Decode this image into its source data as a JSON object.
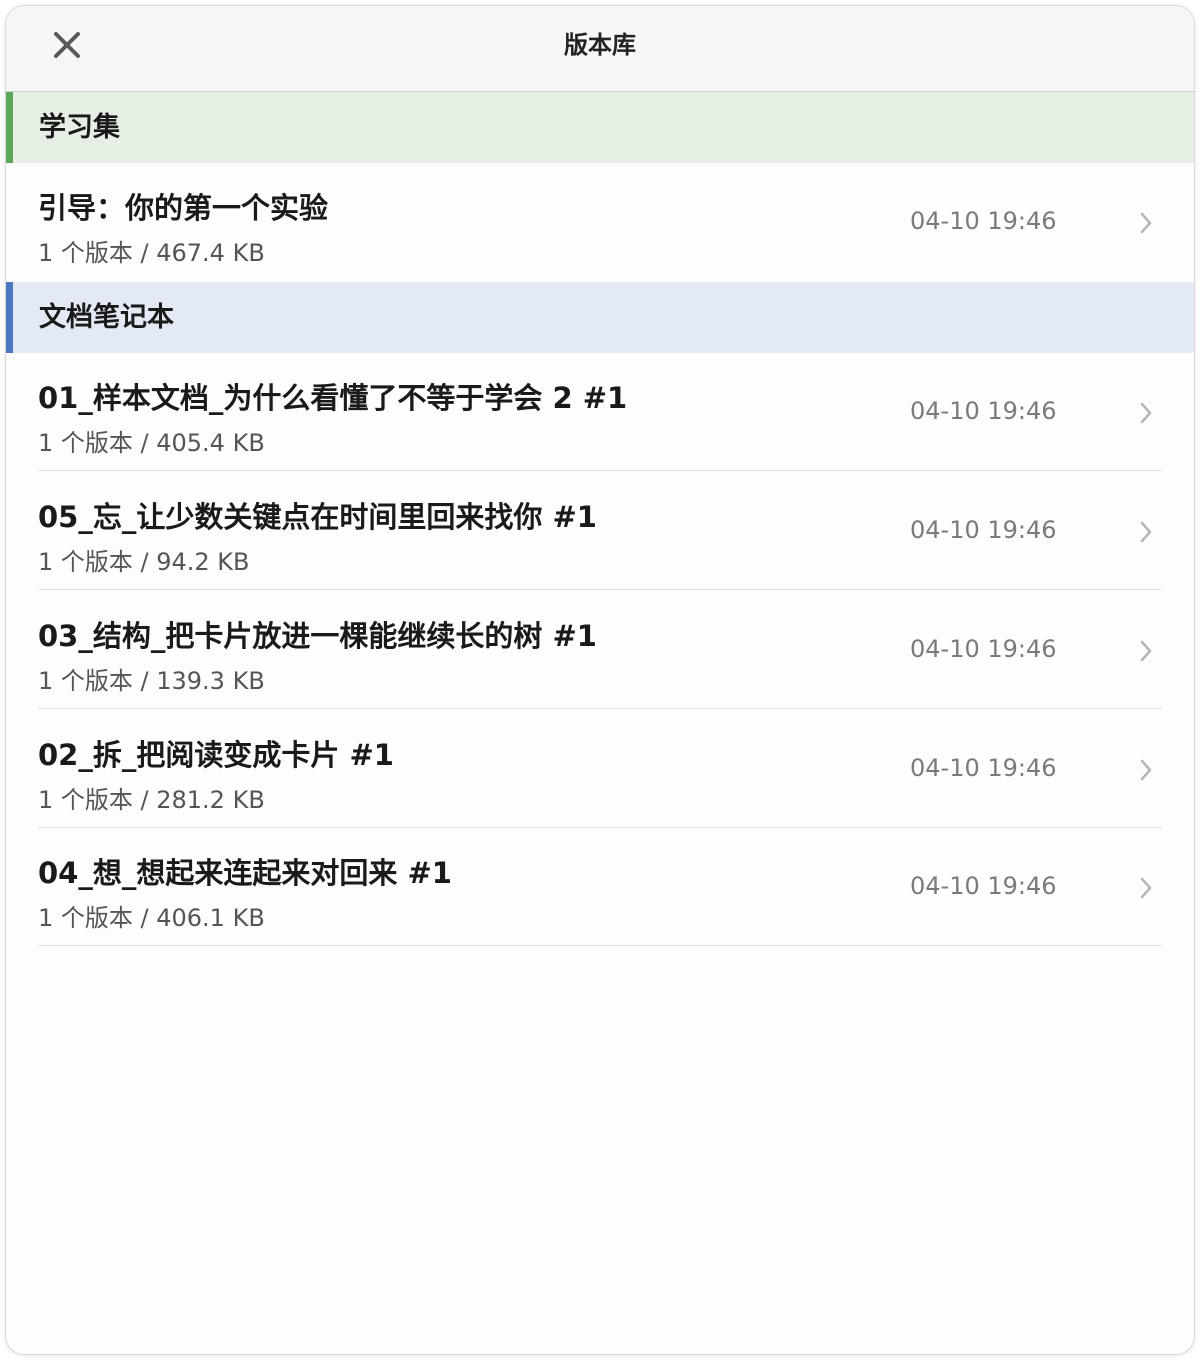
{
  "window": {
    "title": "版本库",
    "close_icon": "close-icon"
  },
  "colors": {
    "section_learning_bg": "#e5efe3",
    "section_learning_accent": "#5aa85a",
    "section_docs_bg": "#e3eaf5",
    "section_docs_accent": "#4a78c0"
  },
  "sections": [
    {
      "label": "学习集",
      "items": [
        {
          "title": "引导：你的第一个实验",
          "subtitle": "1 个版本 / 467.4 KB",
          "time": "04-10 19:46"
        }
      ]
    },
    {
      "label": "文档笔记本",
      "items": [
        {
          "title": "01_样本文档_为什么看懂了不等于学会 2 #1",
          "subtitle": "1 个版本 / 405.4 KB",
          "time": "04-10 19:46"
        },
        {
          "title": "05_忘_让少数关键点在时间里回来找你 #1",
          "subtitle": "1 个版本 / 94.2 KB",
          "time": "04-10 19:46"
        },
        {
          "title": "03_结构_把卡片放进一棵能继续长的树 #1",
          "subtitle": "1 个版本 / 139.3 KB",
          "time": "04-10 19:46"
        },
        {
          "title": "02_拆_把阅读变成卡片 #1",
          "subtitle": "1 个版本 / 281.2 KB",
          "time": "04-10 19:46"
        },
        {
          "title": "04_想_想起来连起来对回来 #1",
          "subtitle": "1 个版本 / 406.1 KB",
          "time": "04-10 19:46"
        }
      ]
    }
  ]
}
